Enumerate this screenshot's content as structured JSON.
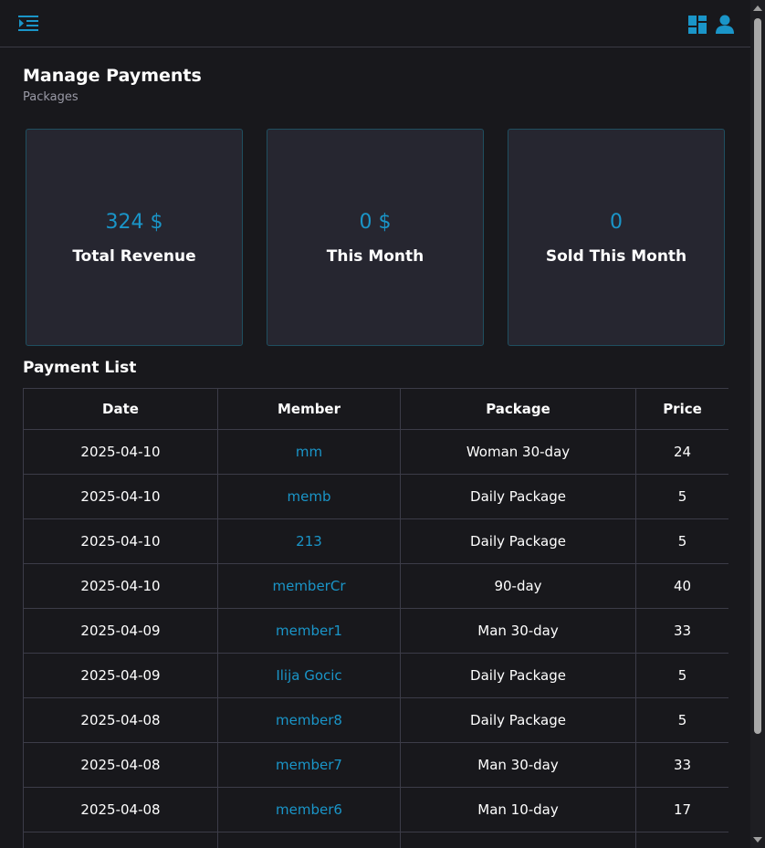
{
  "page": {
    "title": "Manage Payments",
    "subtitle": "Packages"
  },
  "colors": {
    "accent": "#1a95c8",
    "background": "#18181c",
    "card_background": "#262630",
    "border": "#3c3c48"
  },
  "icons": {
    "menu": "menu-collapse-icon",
    "dashboard": "dashboard-icon",
    "user": "user-icon"
  },
  "stats": [
    {
      "value": "324 $",
      "label": "Total Revenue"
    },
    {
      "value": "0 $",
      "label": "This Month"
    },
    {
      "value": "0",
      "label": "Sold This Month"
    }
  ],
  "payments": {
    "title": "Payment List",
    "columns": [
      "Date",
      "Member",
      "Package",
      "Price"
    ],
    "rows": [
      {
        "date": "2025-04-10",
        "member": "mm",
        "package": "Woman 30-day",
        "price": "24"
      },
      {
        "date": "2025-04-10",
        "member": "memb",
        "package": "Daily Package",
        "price": "5"
      },
      {
        "date": "2025-04-10",
        "member": "213",
        "package": "Daily Package",
        "price": "5"
      },
      {
        "date": "2025-04-10",
        "member": "memberCr",
        "package": "90-day",
        "price": "40"
      },
      {
        "date": "2025-04-09",
        "member": "member1",
        "package": "Man 30-day",
        "price": "33"
      },
      {
        "date": "2025-04-09",
        "member": "Ilija Gocic",
        "package": "Daily Package",
        "price": "5"
      },
      {
        "date": "2025-04-08",
        "member": "member8",
        "package": "Daily Package",
        "price": "5"
      },
      {
        "date": "2025-04-08",
        "member": "member7",
        "package": "Man 30-day",
        "price": "33"
      },
      {
        "date": "2025-04-08",
        "member": "member6",
        "package": "Man 10-day",
        "price": "17"
      },
      {
        "date": "",
        "member": "",
        "package": "",
        "price": ""
      }
    ]
  }
}
